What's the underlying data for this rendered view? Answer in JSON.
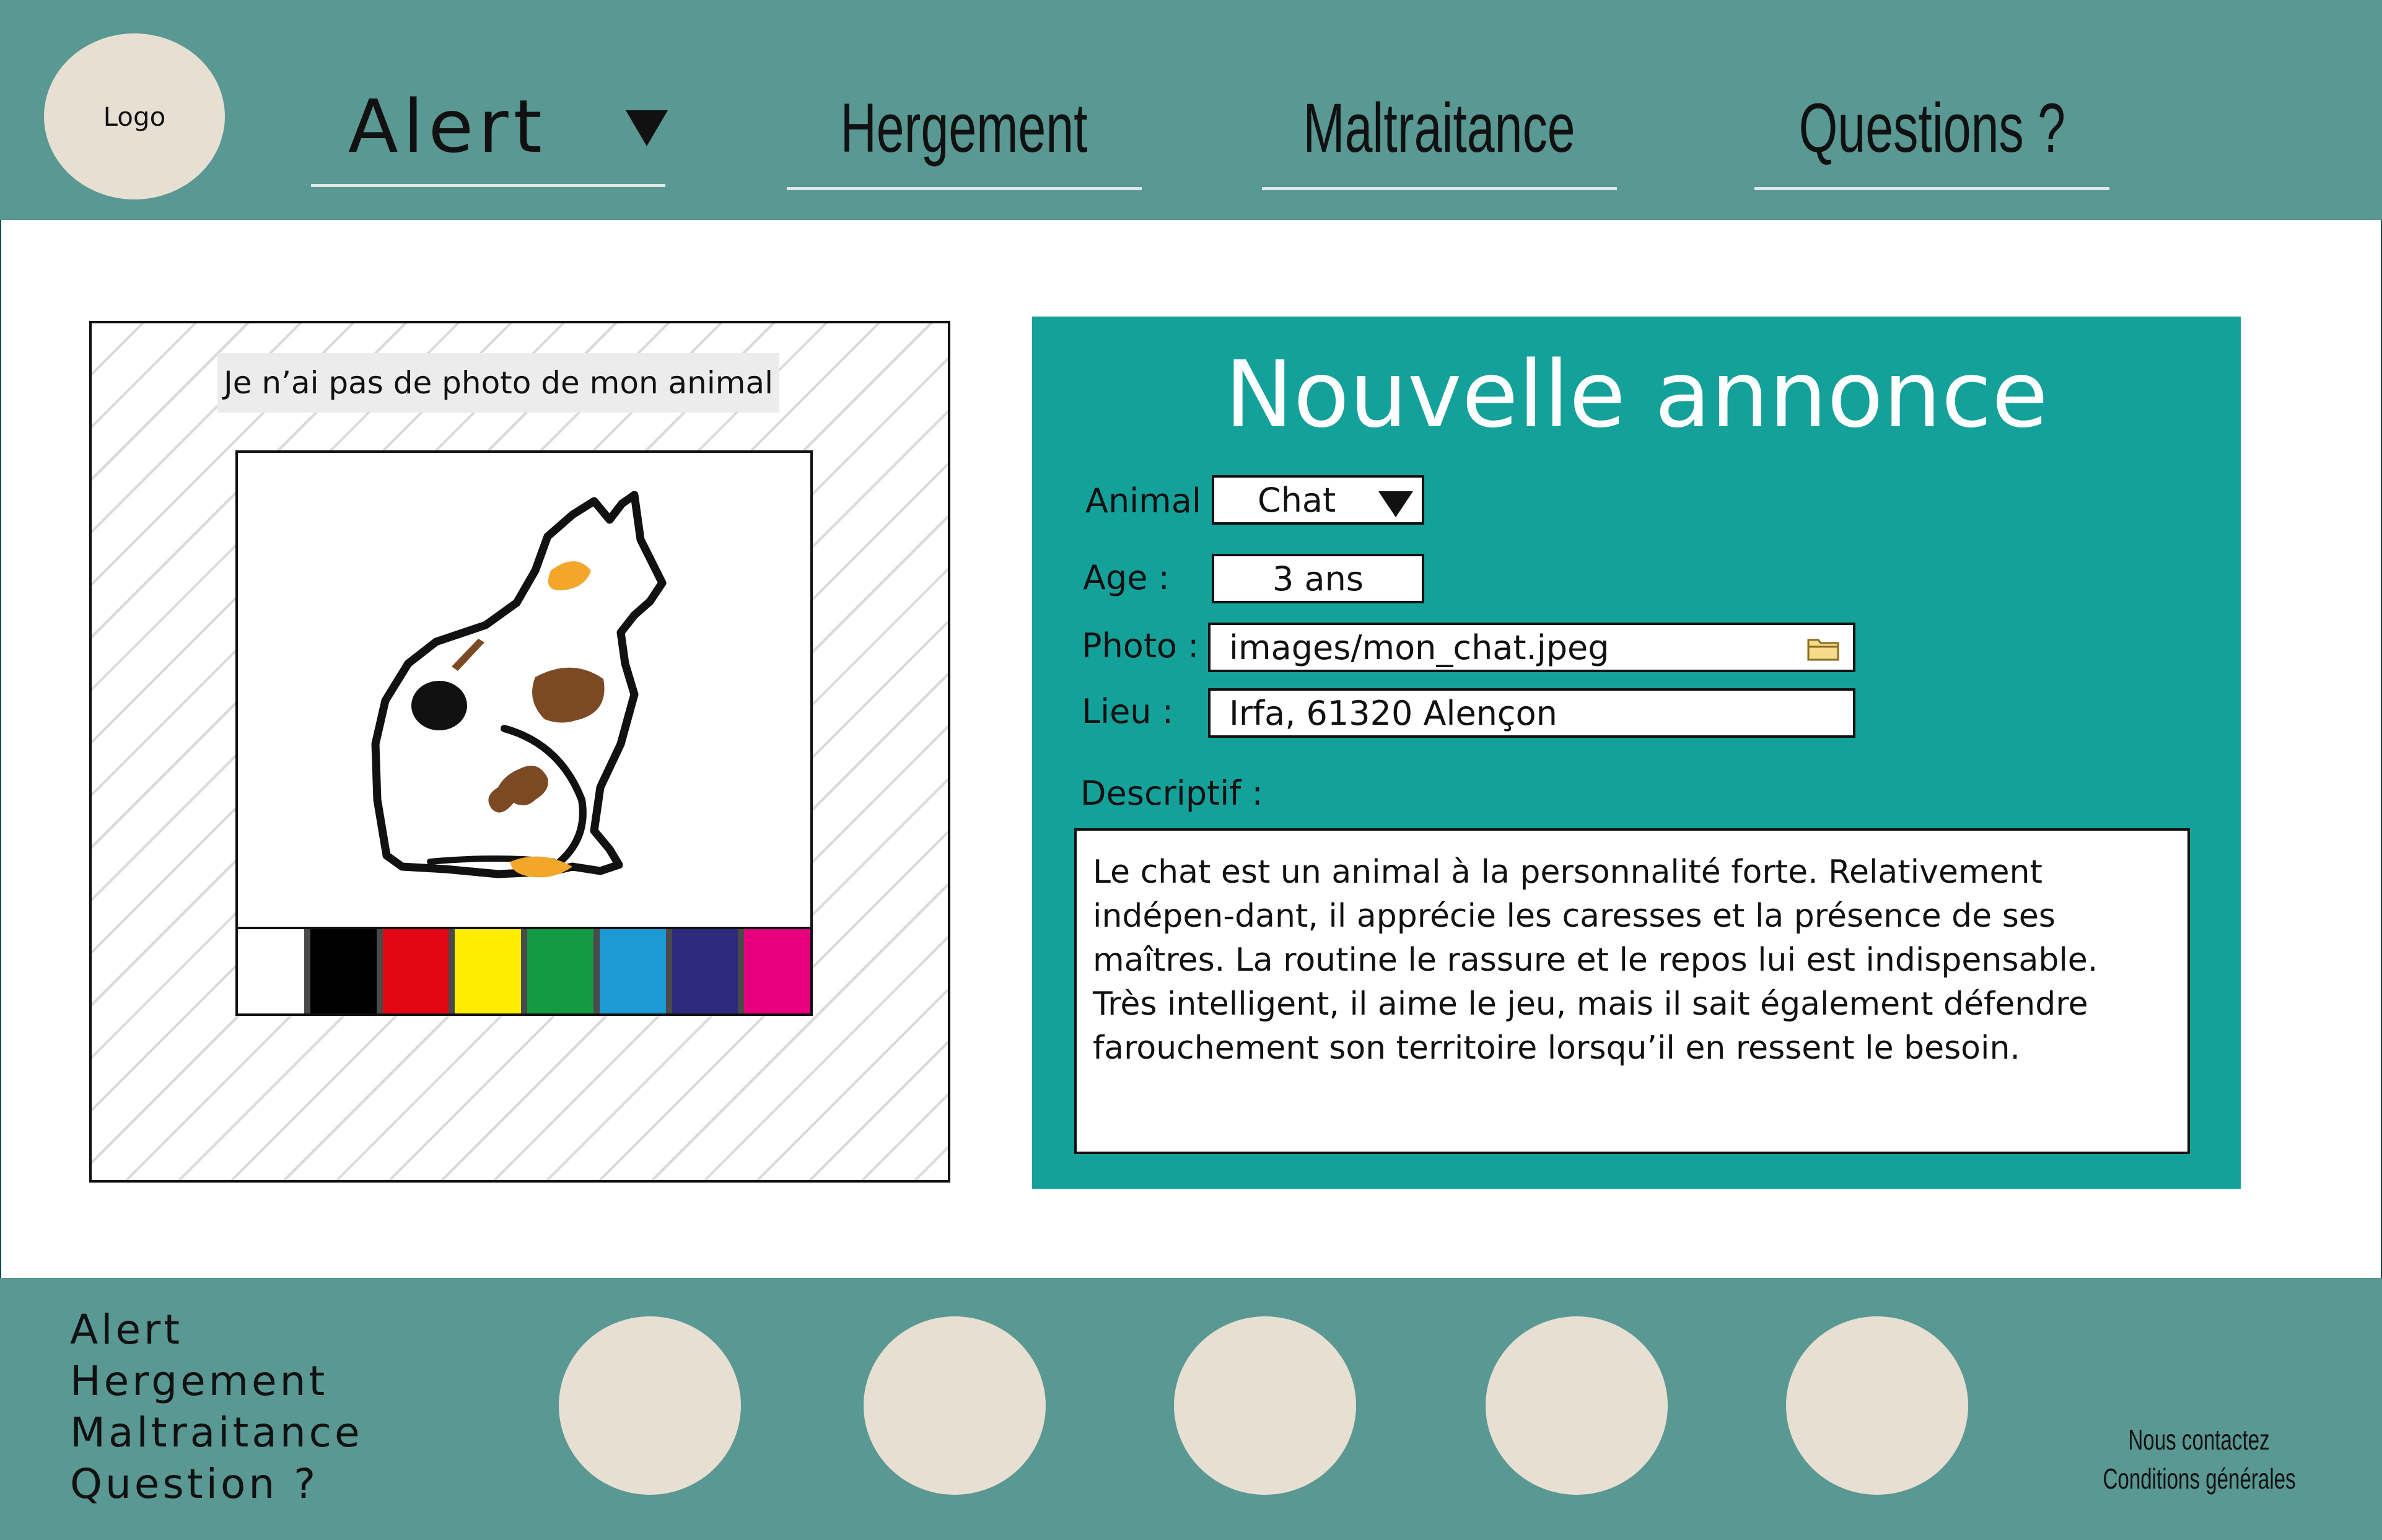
{
  "header": {
    "logo_text": "Logo",
    "nav": {
      "alert": "Alert",
      "hergement": "Hergement",
      "maltraitance": "Maltraitance",
      "questions": "Questions ?"
    }
  },
  "photo_panel": {
    "no_photo_label": "Je n’ai pas de photo de mon animal",
    "swatch_colors": [
      "#ffffff",
      "#000000",
      "#e30613",
      "#ffed00",
      "#139a43",
      "#1d9ad6",
      "#2e2a7c",
      "#e6007e"
    ]
  },
  "form": {
    "title": "Nouvelle annonce",
    "animal_label": "Animal :",
    "animal_value": "Chat",
    "age_label": "Age :",
    "age_value": "3 ans",
    "photo_label": "Photo :",
    "photo_value": "images/mon_chat.jpeg",
    "lieu_label": "Lieu :",
    "lieu_value": "Irfa, 61320 Alençon",
    "descriptif_label": "Descriptif :",
    "descriptif_value": "Le chat est un animal à la personnalité forte. Relativement indépen-dant, il apprécie les caresses et la présence de ses maîtres. La routine le rassure et le repos lui est indispensable. Très intelligent, il aime le jeu, mais il sait également défendre farouchement son territoire lorsqu’il en ressent le besoin."
  },
  "footer": {
    "links": [
      "Alert",
      "Hergement",
      "Maltraitance",
      "Question ?"
    ],
    "contact": "Nous contactez",
    "terms": "Conditions générales"
  },
  "colors": {
    "header_bg": "#599893",
    "form_bg": "#14a19a",
    "placeholder_circle": "#e8dfd3"
  }
}
